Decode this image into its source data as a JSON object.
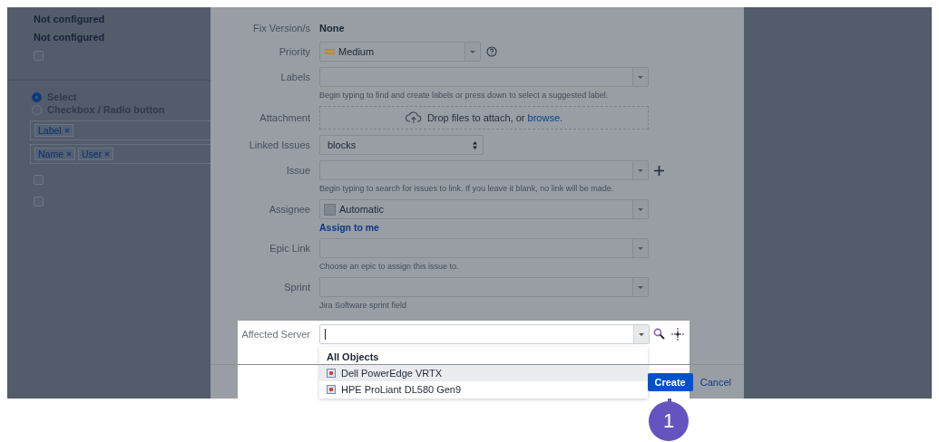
{
  "sidebar": {
    "values": [
      "Not configured",
      "Not configured"
    ],
    "top_checkbox": {
      "checked": false
    },
    "radios": [
      {
        "label": "Select",
        "selected": true
      },
      {
        "label": "Checkbox / Radio button",
        "selected": false
      }
    ],
    "tag_fields": [
      {
        "tags": [
          "Label"
        ]
      },
      {
        "tags": [
          "Name",
          "User"
        ]
      }
    ],
    "checkboxes": [
      {
        "checked": false
      },
      {
        "checked": false
      }
    ]
  },
  "form": {
    "fields": [
      {
        "kind": "static",
        "label": "Fix Version/s",
        "value": "None"
      },
      {
        "kind": "priority",
        "label": "Priority",
        "value": "Medium"
      },
      {
        "kind": "picker",
        "label": "Labels",
        "hint": "Begin typing to find and create labels or press down to select a suggested label.",
        "add": false
      },
      {
        "kind": "upload",
        "label": "Attachment",
        "text": "Drop files to attach, or",
        "link": "browse."
      },
      {
        "kind": "native-select",
        "label": "Linked Issues",
        "value": "blocks"
      },
      {
        "kind": "picker",
        "label": "Issue",
        "hint": "Begin typing to search for issues to link. If you leave it blank, no link will be made.",
        "add": true
      },
      {
        "kind": "user",
        "label": "Assignee",
        "value": "Automatic",
        "link": "Assign to me"
      },
      {
        "kind": "picker",
        "label": "Epic Link",
        "hint": "Choose an epic to assign this issue to.",
        "add": false
      },
      {
        "kind": "picker",
        "label": "Sprint",
        "hint": "Jira Software sprint field",
        "add": false
      }
    ]
  },
  "affected_server": {
    "label": "Affected Server",
    "dropdown": {
      "heading": "All Objects",
      "options": [
        {
          "label": "Dell PowerEdge VRTX",
          "selected": true
        },
        {
          "label": "HPE ProLiant DL580 Gen9",
          "selected": false
        }
      ]
    }
  },
  "footer": {
    "create": "Create",
    "cancel": "Cancel"
  },
  "callout": {
    "number": "1"
  }
}
